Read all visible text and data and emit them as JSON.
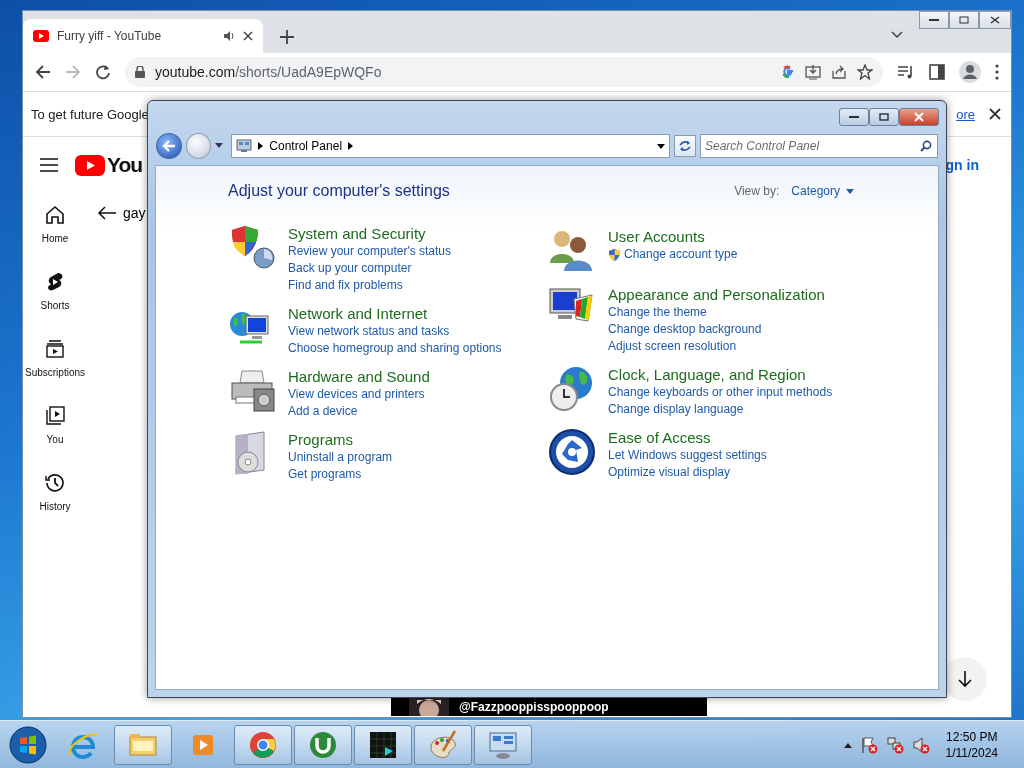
{
  "browser": {
    "tab": {
      "title": "Furry yiff - YouTube"
    },
    "address": {
      "host": "youtube.com",
      "path": "/shorts/UadA9EpWQFo"
    },
    "infobar": {
      "text": "To get future Google",
      "link": "ore"
    },
    "youtube": {
      "logo_text": "You",
      "sign_in": "gn in",
      "back_title": "gay",
      "nav": [
        {
          "kind": "home",
          "label": "Home"
        },
        {
          "kind": "shorts",
          "label": "Shorts"
        },
        {
          "kind": "subscriptions",
          "label": "Subscriptions"
        },
        {
          "kind": "you",
          "label": "You"
        },
        {
          "kind": "history",
          "label": "History"
        }
      ],
      "video_caption": "@Fazzpooppisspooppoop"
    }
  },
  "control_panel": {
    "breadcrumb": "Control Panel",
    "search": {
      "placeholder": "Search Control Panel"
    },
    "heading": "Adjust your computer's settings",
    "view_by_label": "View by:",
    "view_by": "Category",
    "columns": [
      [
        {
          "kind": "security",
          "title": "System and Security",
          "links": [
            {
              "text": "Review your computer's status",
              "shield": false
            },
            {
              "text": "Back up your computer",
              "shield": false
            },
            {
              "text": "Find and fix problems",
              "shield": false
            }
          ]
        },
        {
          "kind": "network",
          "title": "Network and Internet",
          "links": [
            {
              "text": "View network status and tasks",
              "shield": false
            },
            {
              "text": "Choose homegroup and sharing options",
              "shield": false
            }
          ]
        },
        {
          "kind": "hardware",
          "title": "Hardware and Sound",
          "links": [
            {
              "text": "View devices and printers",
              "shield": false
            },
            {
              "text": "Add a device",
              "shield": false
            }
          ]
        },
        {
          "kind": "programs",
          "title": "Programs",
          "links": [
            {
              "text": "Uninstall a program",
              "shield": false
            },
            {
              "text": "Get programs",
              "shield": false
            }
          ]
        }
      ],
      [
        {
          "kind": "users",
          "title": "User Accounts",
          "links": [
            {
              "text": "Change account type",
              "shield": true
            }
          ]
        },
        {
          "kind": "appearance",
          "title": "Appearance and Personalization",
          "links": [
            {
              "text": "Change the theme",
              "shield": false
            },
            {
              "text": "Change desktop background",
              "shield": false
            },
            {
              "text": "Adjust screen resolution",
              "shield": false
            }
          ]
        },
        {
          "kind": "clock",
          "title": "Clock, Language, and Region",
          "links": [
            {
              "text": "Change keyboards or other input methods",
              "shield": false
            },
            {
              "text": "Change display language",
              "shield": false
            }
          ]
        },
        {
          "kind": "access",
          "title": "Ease of Access",
          "links": [
            {
              "text": "Let Windows suggest settings",
              "shield": false
            },
            {
              "text": "Optimize visual display",
              "shield": false
            }
          ]
        }
      ]
    ]
  },
  "taskbar": {
    "clock": {
      "time": "12:50 PM",
      "date": "1/11/2024"
    }
  }
}
